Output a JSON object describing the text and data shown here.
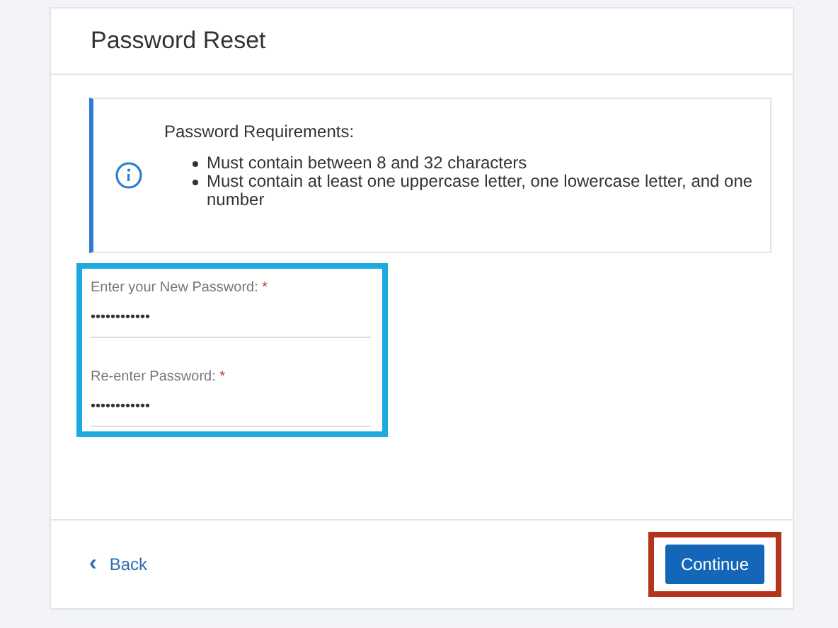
{
  "title": "Password Reset",
  "info": {
    "heading": "Password Requirements:",
    "items": [
      "Must contain between 8 and 32 characters",
      "Must contain at least one uppercase letter, one lowercase letter, and one number"
    ]
  },
  "fields": [
    {
      "label": "Enter your New Password:",
      "required_mark": "*",
      "value": "••••••••••••"
    },
    {
      "label": "Re-enter Password:",
      "required_mark": "*",
      "value": "••••••••••••"
    }
  ],
  "back": {
    "icon": "‹",
    "label": "Back"
  },
  "continue": {
    "label": "Continue"
  }
}
